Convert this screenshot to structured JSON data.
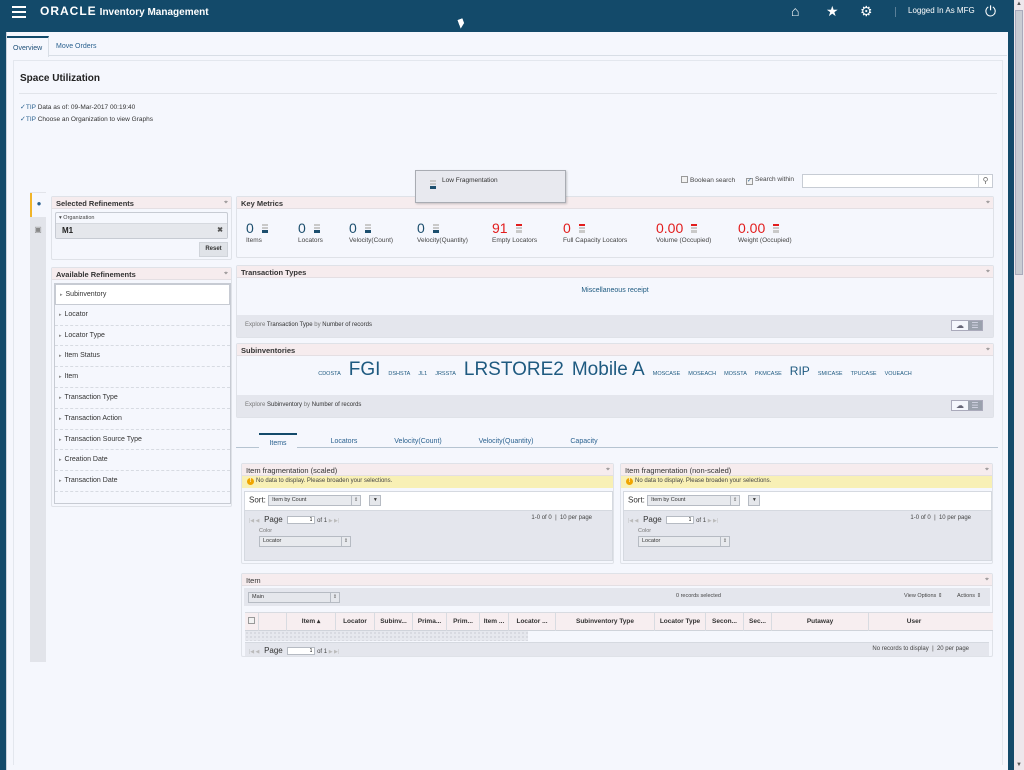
{
  "header": {
    "brand": "ORACLE",
    "app_title": "Inventory Management",
    "logged_in": "Logged In As MFG",
    "icons": [
      "menu-icon",
      "home-icon",
      "star-icon",
      "gear-icon",
      "power-icon"
    ]
  },
  "tabs": [
    {
      "label": "Overview",
      "active": true
    },
    {
      "label": "Move Orders",
      "active": false
    }
  ],
  "page_title": "Space Utilization",
  "tips": [
    {
      "label": "TIP",
      "text": "Data as of: 09-Mar-2017 00:19:40"
    },
    {
      "label": "TIP",
      "text": "Choose an Organization to view Graphs"
    }
  ],
  "search": {
    "boolean_label": "Boolean search",
    "boolean_checked": false,
    "within_label": "Search within",
    "within_checked": true,
    "value": "",
    "placeholder": ""
  },
  "tooltip": {
    "text": "Low Fragmentation"
  },
  "selected_refinements": {
    "title": "Selected Refinements",
    "group_label": "Organization",
    "value": "M1",
    "reset_label": "Reset"
  },
  "available_refinements": {
    "title": "Available Refinements",
    "items": [
      "Subinventory",
      "Locator",
      "Locator Type",
      "Item Status",
      "Item",
      "Transaction Type",
      "Transaction Action",
      "Transaction Source Type",
      "Creation Date",
      "Transaction Date"
    ]
  },
  "key_metrics": {
    "title": "Key Metrics",
    "items": [
      {
        "value": "0",
        "label": "Items",
        "alert": false
      },
      {
        "value": "0",
        "label": "Locators",
        "alert": false
      },
      {
        "value": "0",
        "label": "Velocity(Count)",
        "alert": false
      },
      {
        "value": "0",
        "label": "Velocity(Quantity)",
        "alert": false
      },
      {
        "value": "91",
        "label": "Empty Locators",
        "alert": true
      },
      {
        "value": "0",
        "label": "Full Capacity Locators",
        "alert": true
      },
      {
        "value": "0.00",
        "label": "Volume (Occupied)",
        "alert": true
      },
      {
        "value": "0.00",
        "label": "Weight (Occupied)",
        "alert": true
      }
    ]
  },
  "transaction_types": {
    "title": "Transaction Types",
    "values": [
      "Miscellaneous receipt"
    ],
    "explore_prefix": "Explore",
    "explore_attr": "Transaction Type",
    "explore_by": "by",
    "explore_measure": "Number of records"
  },
  "subinventories": {
    "title": "Subinventories",
    "values": [
      {
        "name": "CDOSTA",
        "weight": "small"
      },
      {
        "name": "FGI",
        "weight": "large"
      },
      {
        "name": "DSHSTA",
        "weight": "small"
      },
      {
        "name": "JL1",
        "weight": "small"
      },
      {
        "name": "JRSSTA",
        "weight": "small"
      },
      {
        "name": "LRSTORE2",
        "weight": "large"
      },
      {
        "name": "Mobile A",
        "weight": "large"
      },
      {
        "name": "MOSCASE",
        "weight": "small"
      },
      {
        "name": "MOSEACH",
        "weight": "small"
      },
      {
        "name": "MOSSTA",
        "weight": "small"
      },
      {
        "name": "PKMCASE",
        "weight": "small"
      },
      {
        "name": "RIP",
        "weight": "medium"
      },
      {
        "name": "SMICASE",
        "weight": "small"
      },
      {
        "name": "TPUCASE",
        "weight": "small"
      },
      {
        "name": "VOUEACH",
        "weight": "small"
      }
    ],
    "explore_prefix": "Explore",
    "explore_attr": "Subinventory",
    "explore_by": "by",
    "explore_measure": "Number of records"
  },
  "sub_tabs": [
    {
      "label": "Items",
      "active": true
    },
    {
      "label": "Locators",
      "active": false
    },
    {
      "label": "Velocity(Count)",
      "active": false
    },
    {
      "label": "Velocity(Quantity)",
      "active": false
    },
    {
      "label": "Capacity",
      "active": false
    }
  ],
  "frag_scaled": {
    "title": "Item fragmentation (scaled)",
    "warning": "No data to display. Please broaden your selections.",
    "sort_label": "Sort:",
    "sort_value": "Item by Count",
    "page_label": "Page",
    "page_value": "1",
    "page_of": "of 1",
    "range": "1-0 of 0",
    "per_page": "10 per page",
    "color_label": "Color",
    "color_value": "Locator"
  },
  "frag_nonscaled": {
    "title": "Item fragmentation (non-scaled)",
    "warning": "No data to display. Please broaden your selections.",
    "sort_label": "Sort:",
    "sort_value": "Item by Count",
    "page_label": "Page",
    "page_value": "1",
    "page_of": "of 1",
    "range": "1-0 of 0",
    "per_page": "10 per page",
    "color_label": "Color",
    "color_value": "Locator"
  },
  "item_table": {
    "title": "Item",
    "view_value": "Main",
    "records_selected": "0 records selected",
    "view_options": "View Options",
    "actions": "Actions",
    "columns": [
      "Item ▴",
      "Locator",
      "Subinv...",
      "Prima...",
      "Prim...",
      "Item ...",
      "Locator ...",
      "Subinventory Type",
      "Locator Type",
      "Secon...",
      "Sec...",
      "Putaway",
      "User"
    ],
    "rows": [],
    "page_label": "Page",
    "page_value": "1",
    "page_of": "of 1",
    "status": "No records to display",
    "per_page": "20 per page"
  }
}
